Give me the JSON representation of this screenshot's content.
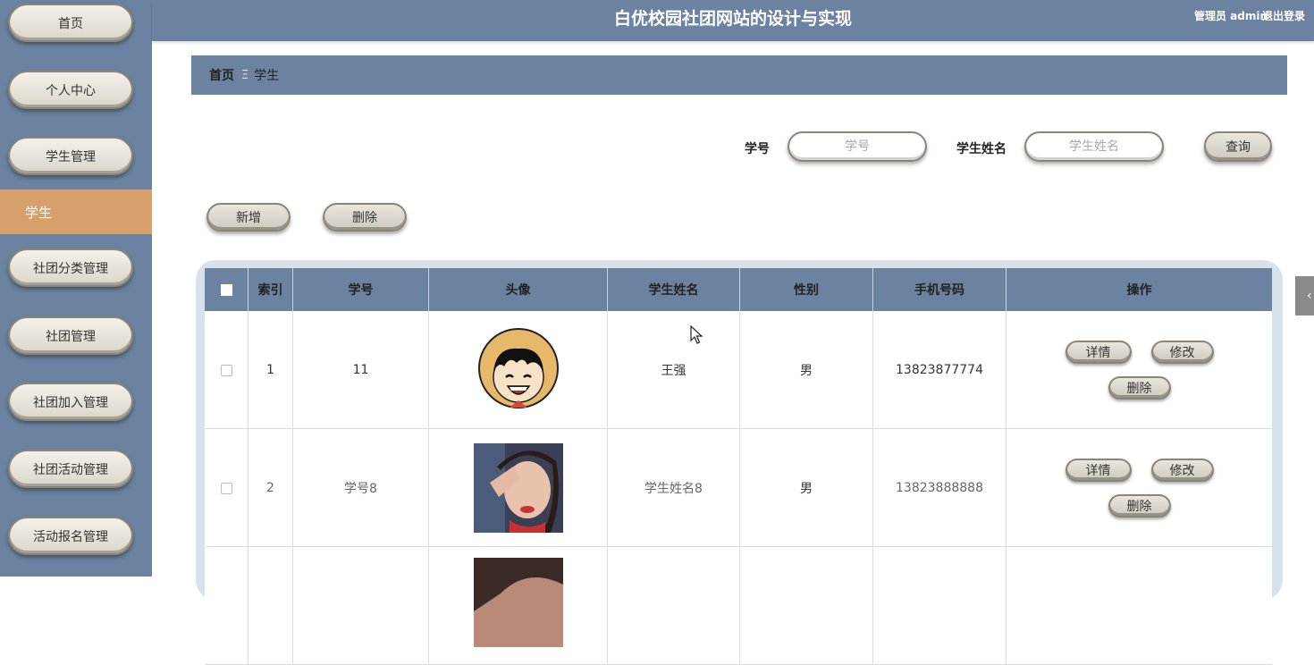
{
  "sidebar": {
    "items": [
      {
        "label": "首页"
      },
      {
        "label": "个人中心"
      },
      {
        "label": "学生管理"
      },
      {
        "label": "学生"
      },
      {
        "label": "社团分类管理"
      },
      {
        "label": "社团管理"
      },
      {
        "label": "社团加入管理"
      },
      {
        "label": "社团活动管理"
      },
      {
        "label": "活动报名管理"
      }
    ]
  },
  "header": {
    "title": "白优校园社团网站的设计与实现",
    "user": "管理员 admin",
    "logout": "退出登录"
  },
  "breadcrumb": {
    "home": "首页",
    "separator": "Ξ",
    "current": "学生"
  },
  "search": {
    "student_no_label": "学号",
    "student_no_placeholder": "学号",
    "name_label": "学生姓名",
    "name_placeholder": "学生姓名",
    "query_button": "查询"
  },
  "actions": {
    "add": "新增",
    "delete": "删除"
  },
  "table": {
    "headers": [
      "索引",
      "学号",
      "头像",
      "学生姓名",
      "性别",
      "手机号码",
      "操作"
    ],
    "rows": [
      {
        "index": "1",
        "student_no": "11",
        "avatar": "cartoon-boy-straw-hat",
        "name": "王强",
        "gender": "男",
        "phone": "13823877774"
      },
      {
        "index": "2",
        "student_no": "学号8",
        "avatar": "girl-photo",
        "name": "学生姓名8",
        "gender": "男",
        "phone": "13823888888"
      }
    ],
    "row_buttons": {
      "detail": "详情",
      "edit": "修改",
      "delete": "删除"
    }
  },
  "colors": {
    "primary": "#6b83a0",
    "active": "#d6a06c",
    "table_frame": "#d7e2ea"
  }
}
